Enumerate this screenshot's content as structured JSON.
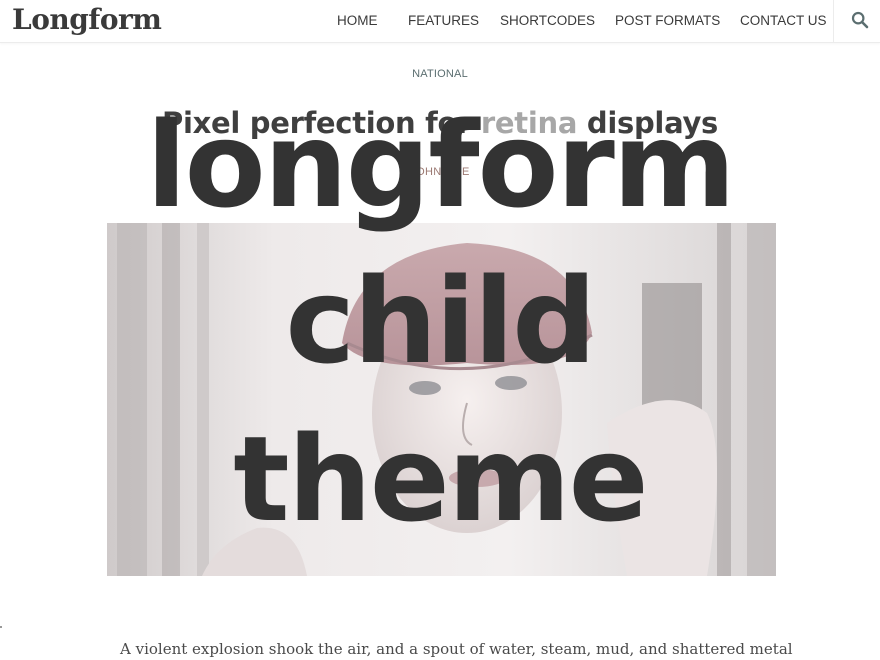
{
  "header": {
    "logo": "Longform",
    "nav": [
      {
        "label": "HOME"
      },
      {
        "label": "FEATURES"
      },
      {
        "label": "SHORTCODES"
      },
      {
        "label": "POST FORMATS"
      },
      {
        "label": "CONTACT US"
      }
    ],
    "search_icon": "search-icon"
  },
  "post": {
    "category": "NATIONAL",
    "title_part1": "Pixel perfection for ",
    "title_highlight": "retina",
    "title_part2": " displays",
    "author": "JOHN DOE",
    "body_first_line": "A violent explosion shook the air, and a spout of water, steam, mud, and shattered metal"
  },
  "overlay": {
    "line1": "longform",
    "line2": "child",
    "line3": "theme"
  },
  "colors": {
    "accent": "#5b6e70",
    "title_highlight": "#a7a7a7",
    "overlay_text": "#333333"
  }
}
